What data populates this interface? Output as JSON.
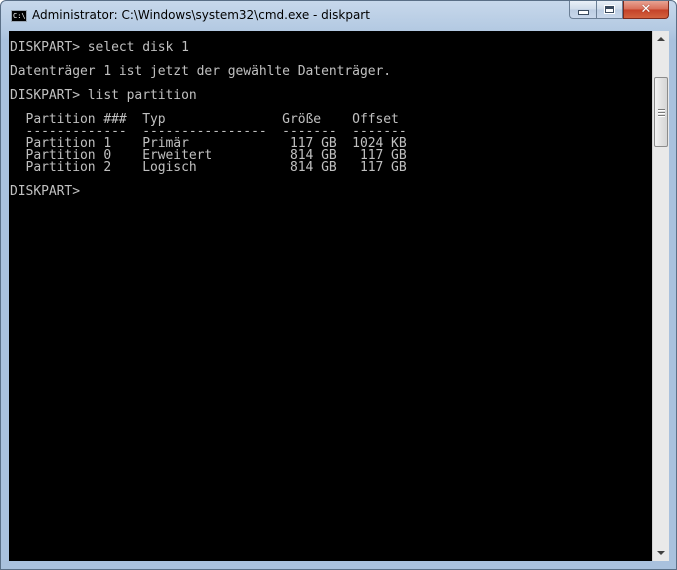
{
  "window": {
    "title": "Administrator: C:\\Windows\\system32\\cmd.exe - diskpart",
    "app_icon_text": "C:\\",
    "buttons": {
      "minimize": "minimize",
      "maximize": "maximize",
      "close": "close"
    }
  },
  "console": {
    "background": "#000000",
    "foreground": "#c0c0c0",
    "lines": [
      "DISKPART> select disk 1",
      "",
      "Datenträger 1 ist jetzt der gewählte Datenträger.",
      "",
      "DISKPART> list partition",
      "",
      "  Partition ###  Typ               Größe    Offset",
      "  -------------  ----------------  -------  -------",
      "  Partition 1    Primär             117 GB  1024 KB",
      "  Partition 0    Erweitert          814 GB   117 GB",
      "  Partition 2    Logisch            814 GB   117 GB",
      "",
      "DISKPART> "
    ]
  },
  "scrollbar": {
    "up_icon": "scroll-up-arrow",
    "down_icon": "scroll-down-arrow"
  }
}
